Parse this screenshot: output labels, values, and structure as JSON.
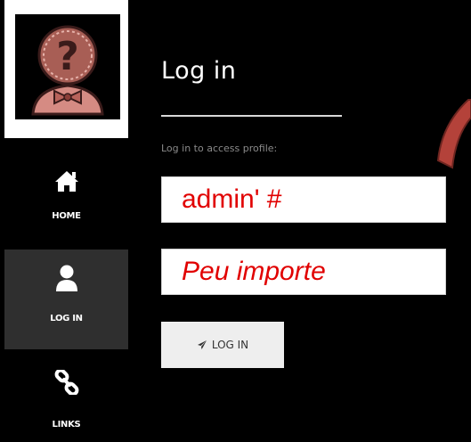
{
  "sidebar": {
    "avatar_icon": "question-mark-avatar-icon",
    "items": [
      {
        "label": "HOME",
        "icon": "home-icon"
      },
      {
        "label": "LOG IN",
        "icon": "user-icon"
      },
      {
        "label": "LINKS",
        "icon": "link-icon"
      }
    ]
  },
  "main": {
    "title": "Log in",
    "subtitle": "Log in to access profile:",
    "username_value": "admin' #",
    "password_value": "Peu importe",
    "login_button_label": "LOG IN",
    "login_button_icon": "paper-plane-icon"
  },
  "colors": {
    "background": "#000000",
    "sidebar_active": "#2f2f2f",
    "input_text": "#e10000",
    "annotation_arrow": "#b4423a"
  }
}
